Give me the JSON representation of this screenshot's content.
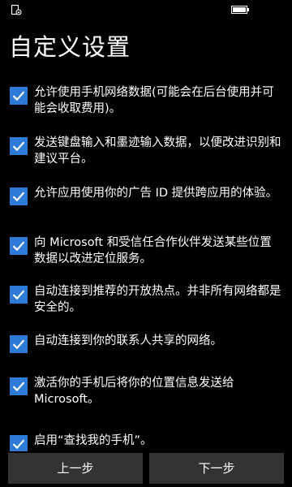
{
  "status_bar": {
    "left_icon": "screen-rotation-lock-icon",
    "right_icon": "battery-icon"
  },
  "page": {
    "title": "自定义设置"
  },
  "colors": {
    "background": "#000000",
    "checkbox_accent": "#2d7bd6",
    "button_background": "#333333",
    "text": "#ffffff"
  },
  "settings": [
    {
      "label": "允许使用手机网络数据(可能会在后台使用并可能会收取费用)。",
      "checked": true
    },
    {
      "label": "发送键盘输入和墨迹输入数据，以便改进识别和建议平台。",
      "checked": true
    },
    {
      "label": "允许应用使用你的广告 ID 提供跨应用的体验。",
      "checked": true
    },
    {
      "label": "向 Microsoft 和受信任合作伙伴发送某些位置数据以改进定位服务。",
      "checked": true
    },
    {
      "label": "自动连接到推荐的开放热点。并非所有网络都是安全的。",
      "checked": true
    },
    {
      "label": "自动连接到你的联系人共享的网络。",
      "checked": true
    },
    {
      "label": "激活你的手机后将你的位置信息发送给 Microsoft。",
      "checked": true
    },
    {
      "label": "启用“查找我的手机”。",
      "checked": true
    }
  ],
  "buttons": {
    "back": "上一步",
    "next": "下一步"
  }
}
